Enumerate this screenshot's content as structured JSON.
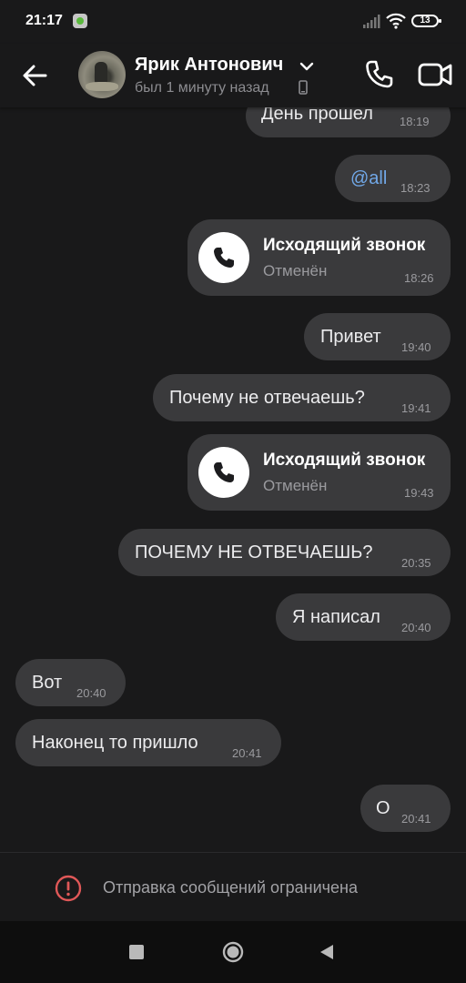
{
  "status_bar": {
    "time": "21:17",
    "battery": "13"
  },
  "header": {
    "contact_name": "Ярик Антонович",
    "last_seen": "был 1 минуту назад"
  },
  "messages": [
    {
      "direction": "out",
      "text": "День прошел",
      "time": "18:19"
    },
    {
      "direction": "out",
      "text": "@all",
      "time": "18:23"
    },
    {
      "direction": "out",
      "type": "call",
      "title": "Исходящий звонок",
      "status": "Отменён",
      "time": "18:26"
    },
    {
      "direction": "out",
      "text": "Привет",
      "time": "19:40"
    },
    {
      "direction": "out",
      "text": "Почему не отвечаешь?",
      "time": "19:41"
    },
    {
      "direction": "out",
      "type": "call",
      "title": "Исходящий звонок",
      "status": "Отменён",
      "time": "19:43"
    },
    {
      "direction": "out",
      "text": "ПОЧЕМУ НЕ ОТВЕЧАЕШЬ?",
      "time": "20:35"
    },
    {
      "direction": "out",
      "text": "Я написал",
      "time": "20:40"
    },
    {
      "direction": "in",
      "text": "Вот",
      "time": "20:40"
    },
    {
      "direction": "in",
      "text": "Наконец то пришло",
      "time": "20:41"
    },
    {
      "direction": "out",
      "text": "О",
      "time": "20:41"
    }
  ],
  "footer": {
    "restricted_text": "Отправка сообщений ограничена"
  },
  "colors": {
    "background": "#19191a",
    "bubble": "#3a3a3c",
    "mention": "#71a8e8",
    "alert": "#e05858"
  }
}
